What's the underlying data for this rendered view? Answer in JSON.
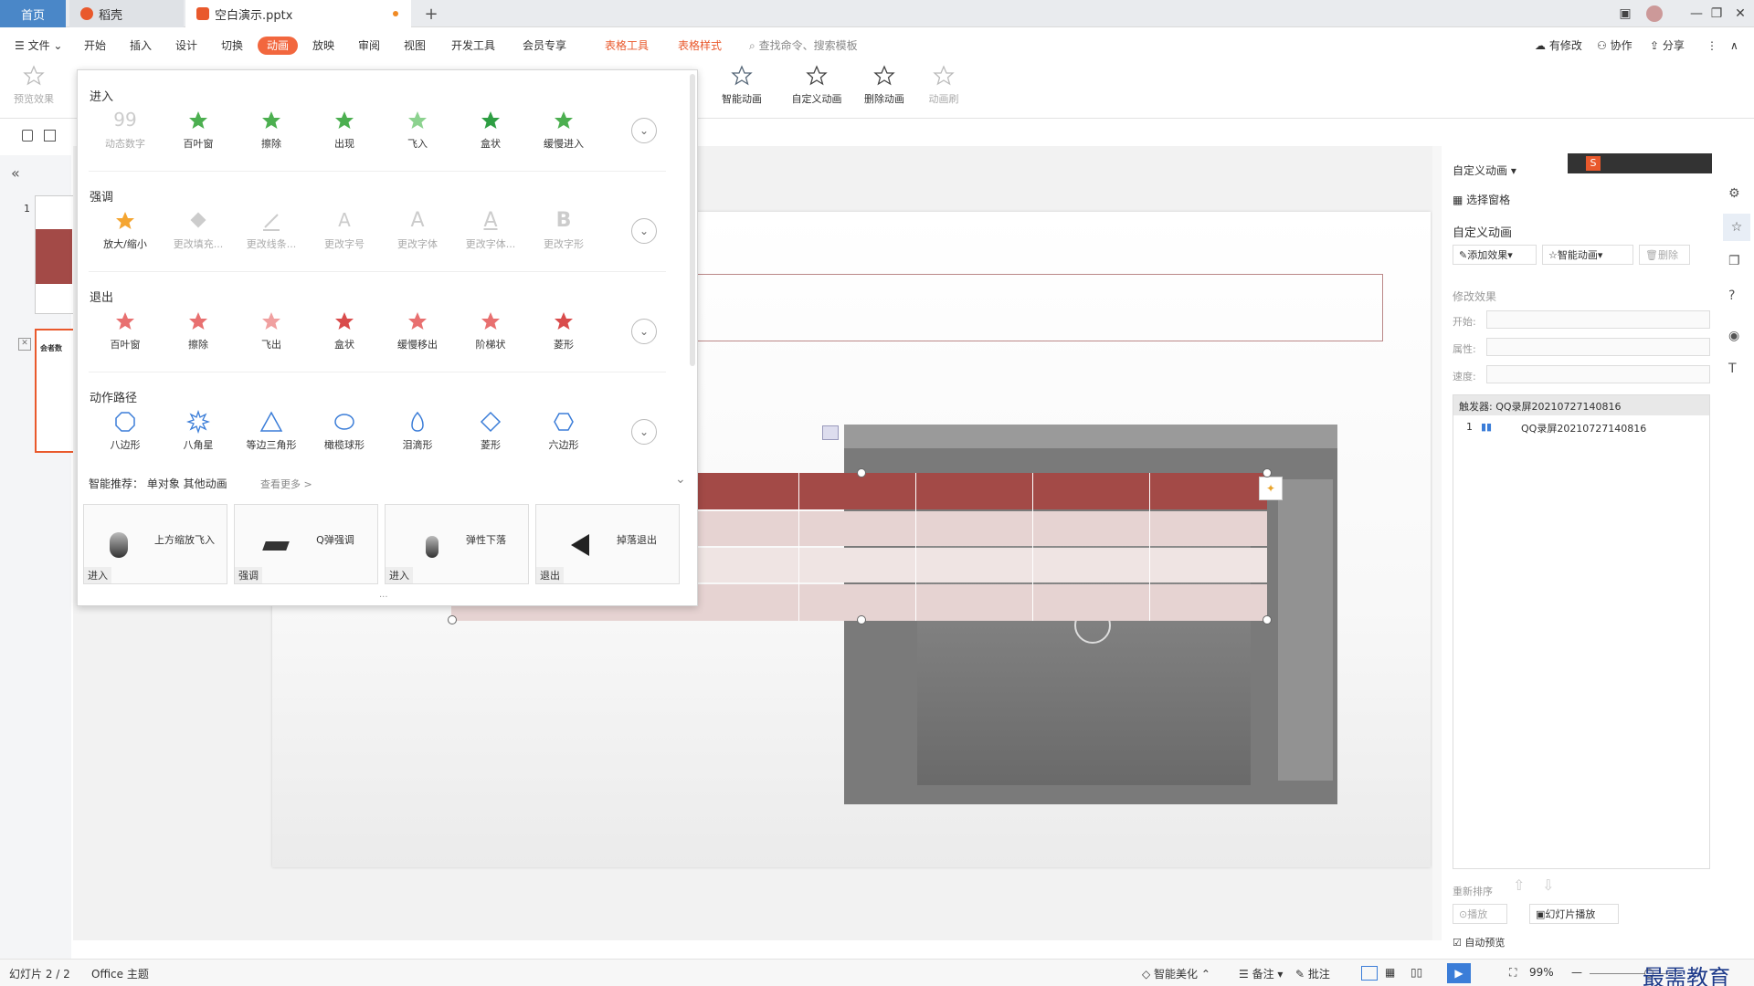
{
  "tabs": {
    "home": "首页",
    "daoke": "稻壳",
    "doc": "空白演示.pptx",
    "new_tab": "+"
  },
  "menu": {
    "file": "文件",
    "items": [
      "开始",
      "插入",
      "设计",
      "切换",
      "动画",
      "放映",
      "审阅",
      "视图",
      "开发工具",
      "会员专享"
    ],
    "active": "动画",
    "table_tools": "表格工具",
    "table_style": "表格样式",
    "search": "查找命令、搜索模板",
    "has_changes": "有修改",
    "collab": "协作",
    "share": "分享"
  },
  "ribbon": {
    "preview": "预览效果",
    "smart_anim": "智能动画",
    "custom_anim": "自定义动画",
    "delete_anim": "删除动画",
    "anim_painter": "动画刷"
  },
  "popup": {
    "enter": {
      "title": "进入",
      "items": [
        "动态数字",
        "百叶窗",
        "擦除",
        "出现",
        "飞入",
        "盒状",
        "缓慢进入"
      ]
    },
    "emphasis": {
      "title": "强调",
      "items": [
        "放大/缩小",
        "更改填充...",
        "更改线条...",
        "更改字号",
        "更改字体",
        "更改字体...",
        "更改字形"
      ]
    },
    "exit": {
      "title": "退出",
      "items": [
        "百叶窗",
        "擦除",
        "飞出",
        "盒状",
        "缓慢移出",
        "阶梯状",
        "菱形"
      ]
    },
    "path": {
      "title": "动作路径",
      "items": [
        "八边形",
        "八角星",
        "等边三角形",
        "橄榄球形",
        "泪滴形",
        "菱形",
        "六边形"
      ]
    },
    "smart_rec": "智能推荐： 单对象 其他动画",
    "see_more": "查看更多 >",
    "cards": [
      {
        "text": "上方缩放飞入",
        "tag": "进入"
      },
      {
        "text": "Q弹强调",
        "tag": "强调"
      },
      {
        "text": "弹性下落",
        "tag": "进入"
      },
      {
        "text": "掉落退出",
        "tag": "退出"
      }
    ],
    "more_dots": "···"
  },
  "left": {
    "collapse": "«",
    "slide1_num": "1",
    "slide2_title": "会者数"
  },
  "right": {
    "header": "自定义动画 ▾",
    "select_pane": "选择窗格",
    "custom_anim": "自定义动画",
    "add_effect": "添加效果",
    "smart_anim": "智能动画",
    "delete": "删除",
    "modify": "修改效果",
    "start": "开始:",
    "property": "属性:",
    "speed": "速度:",
    "trigger": "触发器: QQ录屏20210727140816",
    "anim_item_num": "1",
    "anim_item": "QQ录屏20210727140816",
    "reorder": "重新排序",
    "play": "播放",
    "slideshow": "幻灯片播放",
    "auto_preview": "自动预览"
  },
  "status": {
    "slide": "幻灯片 2 / 2",
    "theme": "Office 主题",
    "smart_beautify": "智能美化",
    "notes": "备注",
    "comment": "批注",
    "zoom": "99%",
    "watermark": "最需教育"
  },
  "colors": {
    "accent": "#f2673e",
    "table_header": "#a34a47",
    "table_row": "#e6d3d2",
    "home_tab": "#4a87c8"
  }
}
